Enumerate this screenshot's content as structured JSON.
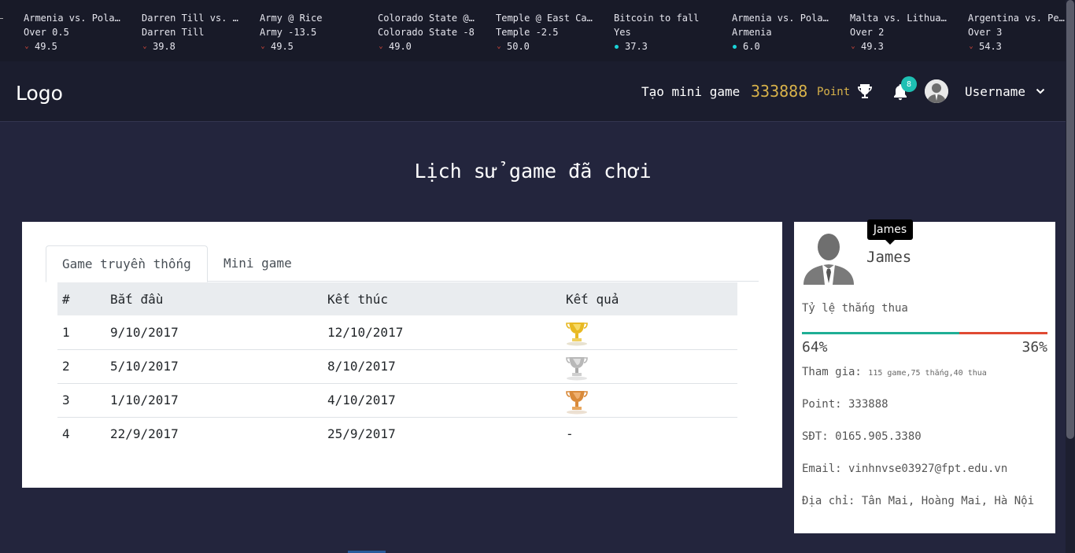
{
  "ticker": [
    {
      "line1": "Armenia vs. Poland",
      "line2": "Over 0.5",
      "value": "49.5",
      "trend": "down"
    },
    {
      "line1": "Darren Till vs. Stephen",
      "line2": "Darren Till",
      "value": "39.8",
      "trend": "down"
    },
    {
      "line1": "Army @ Rice",
      "line2": "Army -13.5",
      "value": "49.5",
      "trend": "down"
    },
    {
      "line1": "Colorado State @ Air",
      "line2": "Colorado State -8",
      "value": "49.0",
      "trend": "down"
    },
    {
      "line1": "Temple @ East Carolina",
      "line2": "Temple -2.5",
      "value": "50.0",
      "trend": "down"
    },
    {
      "line1": "Bitcoin to fall",
      "line2": "Yes",
      "value": "37.3",
      "trend": "up"
    },
    {
      "line1": "Armenia vs. Poland",
      "line2": "Armenia",
      "value": "6.0",
      "trend": "up"
    },
    {
      "line1": "Malta vs. Lithuania",
      "line2": "Over 2",
      "value": "49.3",
      "trend": "down"
    },
    {
      "line1": "Argentina vs. Peru",
      "line2": "Over 3",
      "value": "54.3",
      "trend": "down"
    }
  ],
  "header": {
    "logo": "Logo",
    "create_mini_game": "Tạo mini game",
    "points_value": "333888",
    "points_label": "Point",
    "notification_count": "8",
    "username": "Username"
  },
  "page_title": "Lịch sử game đã chơi",
  "tabs": [
    {
      "label": "Game truyền thống",
      "active": true
    },
    {
      "label": "Mini game",
      "active": false
    }
  ],
  "table": {
    "headers": [
      "#",
      "Bắt đầu",
      "Kết thúc",
      "Kết quả"
    ],
    "rows": [
      {
        "num": "1",
        "start": "9/10/2017",
        "end": "12/10/2017",
        "result": "gold-trophy-icon"
      },
      {
        "num": "2",
        "start": "5/10/2017",
        "end": "8/10/2017",
        "result": "silver-trophy-icon"
      },
      {
        "num": "3",
        "start": "1/10/2017",
        "end": "4/10/2017",
        "result": "bronze-trophy-icon"
      },
      {
        "num": "4",
        "start": "22/9/2017",
        "end": "25/9/2017",
        "result": "-"
      }
    ]
  },
  "profile": {
    "name": "James",
    "tooltip": "James",
    "ratio_label": "Tỷ lệ thắng thua",
    "win_percent": "64%",
    "lose_percent": "36%",
    "win_fraction": 0.64,
    "participation_label": "Tham gia:",
    "participation_detail": "115 game,75 thắng,40 thua",
    "point": "Point: 333888",
    "phone": "SĐT: 0165.905.3380",
    "email": "Email: vinhnvse03927@fpt.edu.vn",
    "address": "Địa chỉ: Tân Mai, Hoàng Mai, Hà Nội"
  },
  "colors": {
    "gold": "#d8b24a",
    "win": "#1fae95",
    "lose": "#e04a33",
    "trend_down": "#e24a3b",
    "trend_up": "#1ad3d8",
    "badge": "#1ec0b3"
  }
}
